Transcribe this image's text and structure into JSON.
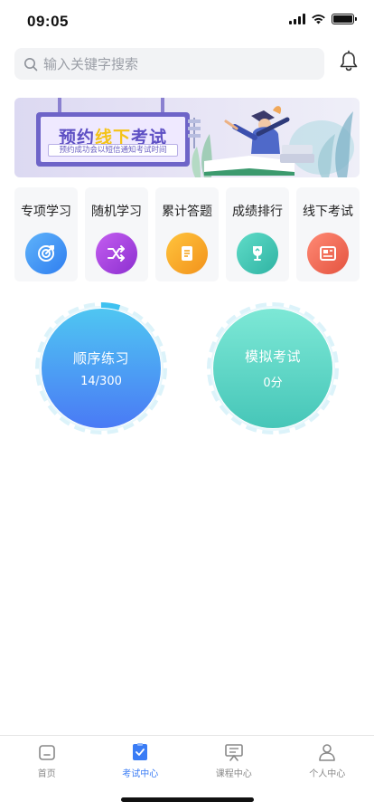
{
  "status_bar": {
    "time": "09:05"
  },
  "search": {
    "placeholder": "输入关键字搜索",
    "value": ""
  },
  "banner": {
    "title_pre": "预约",
    "title_highlight": "线下",
    "title_post": "考试",
    "subtitle": "预约成功会以短信通知考试时间"
  },
  "features": [
    {
      "label": "专项学习",
      "icon": "target-icon",
      "color": "#3d8ef5"
    },
    {
      "label": "随机学习",
      "icon": "shuffle-icon",
      "color": "#a440e0"
    },
    {
      "label": "累计答题",
      "icon": "note-icon",
      "color": "#f5a623"
    },
    {
      "label": "成绩排行",
      "icon": "trophy-icon",
      "color": "#3cc6b5"
    },
    {
      "label": "线下考试",
      "icon": "newspaper-icon",
      "color": "#ef6b5b"
    }
  ],
  "practice": {
    "sequential": {
      "title": "顺序练习",
      "value": "14/300",
      "progress": 0.0467
    },
    "mock_exam": {
      "title": "模拟考试",
      "value": "0分"
    }
  },
  "tabs": [
    {
      "label": "首页",
      "icon": "home-icon",
      "active": false
    },
    {
      "label": "考试中心",
      "icon": "exam-icon",
      "active": true
    },
    {
      "label": "课程中心",
      "icon": "course-icon",
      "active": false
    },
    {
      "label": "个人中心",
      "icon": "user-icon",
      "active": false
    }
  ],
  "colors": {
    "accent": "#3a7cf5",
    "sequential_gradient": [
      "#4fc6f2",
      "#4a7af5"
    ],
    "mock_gradient": [
      "#7de8d6",
      "#46c6b8"
    ]
  }
}
